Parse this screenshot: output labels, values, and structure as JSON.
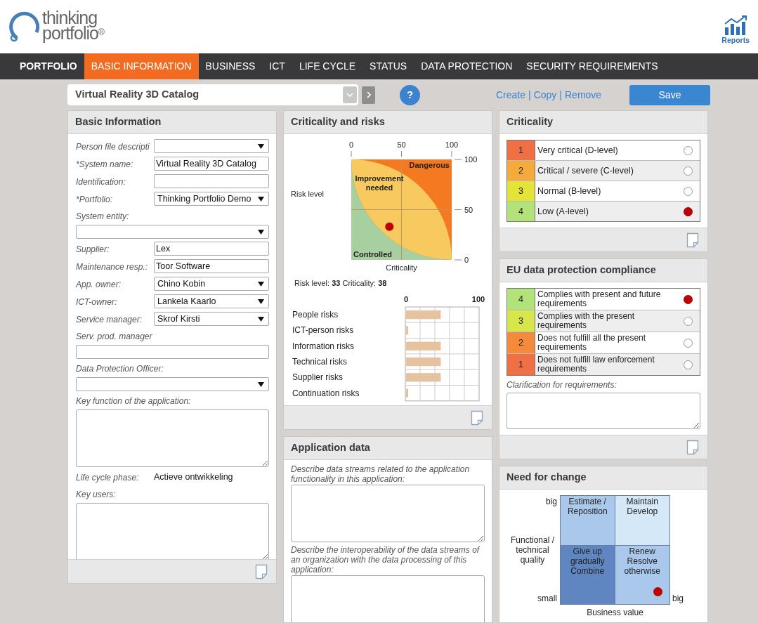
{
  "header": {
    "logo": {
      "line1": "thinking",
      "line2": "portfolio",
      "mark": "®"
    },
    "reports_label": "Reports"
  },
  "nav": [
    {
      "label": "PORTFOLIO",
      "selected": false
    },
    {
      "label": "BASIC INFORMATION",
      "selected": true
    },
    {
      "label": "BUSINESS",
      "selected": false
    },
    {
      "label": "ICT",
      "selected": false
    },
    {
      "label": "LIFE CYCLE",
      "selected": false
    },
    {
      "label": "STATUS",
      "selected": false
    },
    {
      "label": "DATA PROTECTION",
      "selected": false
    },
    {
      "label": "SECURITY REQUIREMENTS",
      "selected": false
    }
  ],
  "toolbar": {
    "application": "Virtual Reality 3D Catalog",
    "help": "?",
    "links": [
      {
        "label": "Create",
        "separator": "|"
      },
      {
        "label": "Copy",
        "separator": "|"
      },
      {
        "label": "Remove"
      }
    ],
    "save": "Save"
  },
  "basic_information": {
    "title": "Basic Information",
    "fields": [
      {
        "label": "Person file descripti",
        "kind": "select",
        "stacked": false
      },
      {
        "label": "*System name:",
        "kind": "text",
        "stacked": false,
        "value": "Virtual Reality 3D Catalog"
      },
      {
        "label": "Identification:",
        "kind": "text",
        "stacked": false
      },
      {
        "label": "*Portfolio:",
        "kind": "select",
        "stacked": false,
        "value": "Thinking Portfolio Demo"
      },
      {
        "label": "System entity:",
        "kind": "select",
        "stacked": true
      },
      {
        "label": "Supplier:",
        "kind": "text",
        "stacked": false,
        "value": "Lex"
      },
      {
        "label": "Maintenance resp.:",
        "kind": "text",
        "stacked": false,
        "value": "Toor Software"
      },
      {
        "label": "App. owner:",
        "kind": "select",
        "stacked": false,
        "value": "Chino Kobin"
      },
      {
        "label": "ICT-owner:",
        "kind": "select",
        "stacked": false,
        "value": "Lankela Kaarlo"
      },
      {
        "label": "Service manager:",
        "kind": "select",
        "stacked": false,
        "value": "Skrof Kirsti"
      },
      {
        "label": "Serv. prod. manager",
        "kind": "text",
        "stacked": true
      },
      {
        "label": "Data Protection Officer:",
        "kind": "select",
        "stacked": true
      },
      {
        "label": "Key function of the application:",
        "kind": "textarea",
        "stacked": true
      },
      {
        "label": "Life cycle phase:",
        "kind": "value",
        "stacked": false,
        "value": "Actieve ontwikkeling"
      },
      {
        "label": "Key users:",
        "kind": "textarea",
        "stacked": true
      }
    ]
  },
  "criticality_and_risks": {
    "title": "Criticality and risks",
    "matrix": {
      "chart_data": {
        "type": "scatter",
        "xlabel": "Criticality",
        "ylabel": "Risk level",
        "x": [
          38
        ],
        "series": [
          {
            "color": "#c00000",
            "values": [
              33
            ]
          }
        ],
        "xlim": [
          0,
          100
        ],
        "ylim": [
          0,
          100
        ],
        "xticks": [
          0,
          50,
          100
        ],
        "yticks": [
          0,
          50,
          100
        ],
        "annotations": [
          "Dangerous",
          "Improvement needed",
          "Controlled"
        ]
      }
    },
    "summary": {
      "risk_label": "Risk level:",
      "risk_value": "33",
      "criticality_label": "Criticality:",
      "criticality_value": "38"
    },
    "risks": {
      "chart_data": {
        "type": "bar",
        "orientation": "horizontal",
        "categories": [
          "People risks",
          "ICT-person risks",
          "Information risks",
          "Technical risks",
          "Supplier risks",
          "Continuation risks"
        ],
        "series": [
          {
            "color": "#e6c3a0",
            "values": [
              48,
              3,
              48,
              48,
              48,
              3
            ]
          }
        ],
        "xlim": [
          0,
          100
        ],
        "xticks": [
          0,
          100
        ]
      }
    }
  },
  "application_data": {
    "title": "Application data",
    "fields": [
      {
        "label": "Describe data streams related to the application functionality in this application:"
      },
      {
        "label": "Describe the interoperability of the data streams of an organization with the data processing of this application:"
      }
    ]
  },
  "criticality": {
    "title": "Criticality",
    "options": [
      {
        "number": "1",
        "label": "Very critical (D-level)",
        "color": "#f07046",
        "selected": false
      },
      {
        "number": "2",
        "label": "Critical / severe (C-level)",
        "color": "#f4ab3c",
        "selected": false
      },
      {
        "number": "3",
        "label": "Normal (B-level)",
        "color": "#e3e33a",
        "selected": false
      },
      {
        "number": "4",
        "label": "Low (A-level)",
        "color": "#b3e27a",
        "selected": true
      }
    ]
  },
  "eu_compliance": {
    "title": "EU data protection compliance",
    "options": [
      {
        "number": "4",
        "label": "Complies with present and future requirements",
        "color": "#b3e27a",
        "selected": true
      },
      {
        "number": "3",
        "label": "Complies with the present requirements",
        "color": "#d7e64a",
        "selected": false
      },
      {
        "number": "2",
        "label": "Does not fulfill all the present requirements",
        "color": "#f38a3c",
        "selected": false
      },
      {
        "number": "1",
        "label": "Does not fulfill law enforcement requirements",
        "color": "#f07046",
        "selected": false
      }
    ],
    "clarification_label": "Clarification for requirements:"
  },
  "need_for_change": {
    "title": "Need for change",
    "y_high": "big",
    "y_low": "small",
    "y_label": "Functional / technical quality",
    "x_high": "big",
    "x_label": "Business value",
    "quadrants": [
      {
        "lines": [
          "Estimate /",
          "Reposition"
        ],
        "color": "#a9c8ec",
        "selected": false
      },
      {
        "lines": [
          "Maintain",
          "Develop"
        ],
        "color": "#d5e8f7",
        "selected": false
      },
      {
        "lines": [
          "Give up",
          "gradually",
          "Combine"
        ],
        "color": "#5f86c1",
        "selected": false
      },
      {
        "lines": [
          "Renew",
          "Resolve",
          "otherwise"
        ],
        "color": "#a9c8ec",
        "selected": true
      }
    ]
  }
}
